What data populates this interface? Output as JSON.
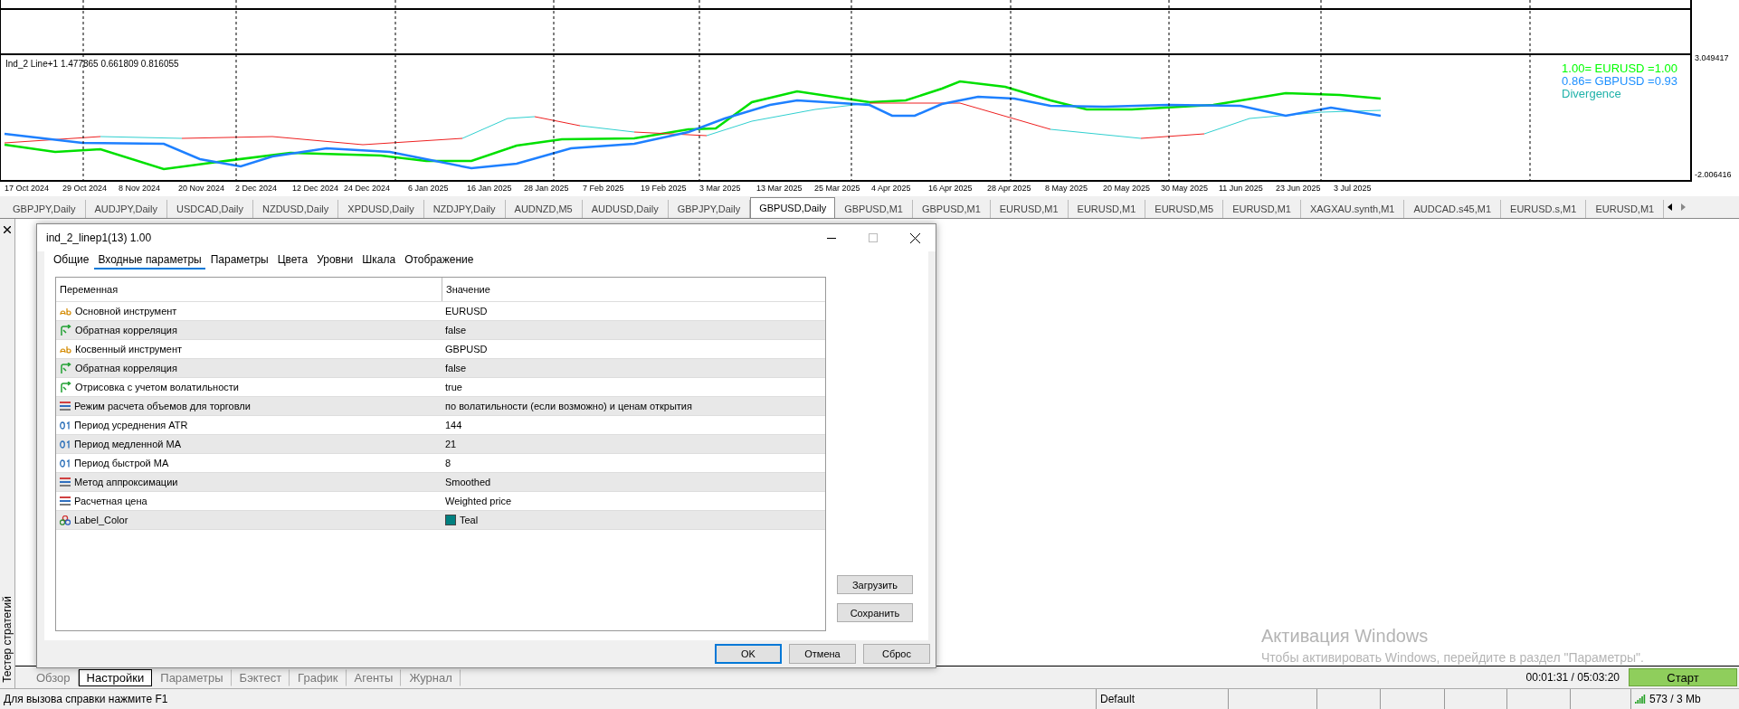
{
  "chart": {
    "indicator_label": "Ind_2 Line+1 1.477865 0.661809 0.816055",
    "y_axis": [
      "3.049417",
      "-2.006416"
    ],
    "dates": [
      "17 Oct 2024",
      "29 Oct 2024",
      "8 Nov 2024",
      "20 Nov 2024",
      "2 Dec 2024",
      "12 Dec 2024",
      "24 Dec 2024",
      "6 Jan 2025",
      "16 Jan 2025",
      "28 Jan 2025",
      "7 Feb 2025",
      "19 Feb 2025",
      "3 Mar 2025",
      "13 Mar 2025",
      "25 Mar 2025",
      "4 Apr 2025",
      "16 Apr 2025",
      "28 Apr 2025",
      "8 May 2025",
      "20 May 2025",
      "30 May 2025",
      "11 Jun 2025",
      "23 Jun 2025",
      "3 Jul 2025"
    ],
    "legend": [
      {
        "text": "1.00= EURUSD =1.00",
        "color": "#00ff00"
      },
      {
        "text": "0.86= GBPUSD =0.93",
        "color": "#1e90ff"
      },
      {
        "text": "Divergence",
        "color": "#20b2aa"
      }
    ]
  },
  "symbol_tabs": [
    {
      "label": "GBPJPY,Daily",
      "selected": false
    },
    {
      "label": "AUDJPY,Daily",
      "selected": false
    },
    {
      "label": "USDCAD,Daily",
      "selected": false
    },
    {
      "label": "NZDUSD,Daily",
      "selected": false
    },
    {
      "label": "XPDUSD,Daily",
      "selected": false
    },
    {
      "label": "NZDJPY,Daily",
      "selected": false
    },
    {
      "label": "AUDNZD,M5",
      "selected": false
    },
    {
      "label": "AUDUSD,Daily",
      "selected": false
    },
    {
      "label": "GBPJPY,Daily",
      "selected": false
    },
    {
      "label": "GBPUSD,Daily",
      "selected": true
    },
    {
      "label": "GBPUSD,M1",
      "selected": false
    },
    {
      "label": "GBPUSD,M1",
      "selected": false
    },
    {
      "label": "EURUSD,M1",
      "selected": false
    },
    {
      "label": "EURUSD,M1",
      "selected": false
    },
    {
      "label": "EURUSD,M5",
      "selected": false
    },
    {
      "label": "EURUSD,M1",
      "selected": false
    },
    {
      "label": "XAGXAU.synth,M1",
      "selected": false
    },
    {
      "label": "AUDCAD.s45,M1",
      "selected": false
    },
    {
      "label": "EURUSD.s,M1",
      "selected": false
    },
    {
      "label": "EURUSD,M1",
      "selected": false
    }
  ],
  "side_panel": {
    "title": "Тестер стратегий"
  },
  "dialog": {
    "title": "ind_2_linep1(13) 1.00",
    "tabs": [
      {
        "label": "Общие",
        "selected": false
      },
      {
        "label": "Входные параметры",
        "selected": true
      },
      {
        "label": "Параметры",
        "selected": false
      },
      {
        "label": "Цвета",
        "selected": false
      },
      {
        "label": "Уровни",
        "selected": false
      },
      {
        "label": "Шкала",
        "selected": false
      },
      {
        "label": "Отображение",
        "selected": false
      }
    ],
    "columns": [
      "Переменная",
      "Значение"
    ],
    "rows": [
      {
        "kind": "string",
        "name": "Основной инструмент",
        "value": "EURUSD"
      },
      {
        "kind": "bool",
        "name": "Обратная корреляция",
        "value": "false"
      },
      {
        "kind": "string",
        "name": "Косвенный инструмент",
        "value": "GBPUSD"
      },
      {
        "kind": "bool",
        "name": "Обратная корреляция",
        "value": "false"
      },
      {
        "kind": "bool",
        "name": "Отрисовка с учетом волатильности",
        "value": "true"
      },
      {
        "kind": "enum",
        "name": "Режим расчета объемов для торговли",
        "value": "по волатильности (если возможно) и ценам открытия"
      },
      {
        "kind": "int",
        "name": "Период усреднения ATR",
        "value": "144"
      },
      {
        "kind": "int",
        "name": "Период медленной MA",
        "value": "21"
      },
      {
        "kind": "int",
        "name": "Период быстрой MA",
        "value": "8"
      },
      {
        "kind": "enum",
        "name": "Метод аппроксимации",
        "value": "Smoothed"
      },
      {
        "kind": "enum",
        "name": "Расчетная цена",
        "value": "Weighted price"
      },
      {
        "kind": "color",
        "name": "Label_Color",
        "value": "Teal",
        "color": "#008080"
      }
    ],
    "side_buttons": [
      "Загрузить",
      "Сохранить"
    ],
    "buttons": [
      "OK",
      "Отмена",
      "Сброс"
    ]
  },
  "tester_tabs": [
    {
      "label": "Обзор",
      "selected": false
    },
    {
      "label": "Настройки",
      "selected": true
    },
    {
      "label": "Параметры",
      "selected": false
    },
    {
      "label": "Бэктест",
      "selected": false
    },
    {
      "label": "График",
      "selected": false
    },
    {
      "label": "Агенты",
      "selected": false
    },
    {
      "label": "Журнал",
      "selected": false
    }
  ],
  "timer": "00:01:31 / 05:03:20",
  "start_button": "Старт",
  "activation": {
    "title": "Активация Windows",
    "text": "Чтобы активировать Windows, перейдите в раздел \"Параметры\"."
  },
  "status_bar": {
    "help": "Для вызова справки нажмите F1",
    "profile": "Default",
    "traffic": "573 / 3 Mb"
  }
}
